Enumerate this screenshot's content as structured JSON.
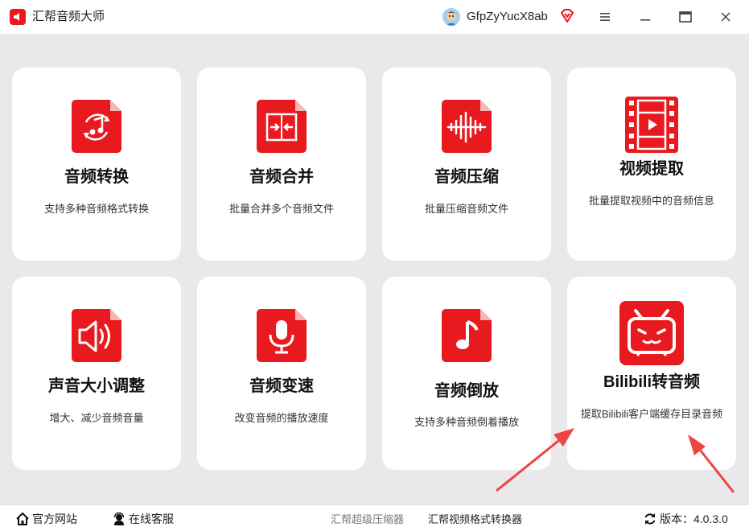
{
  "app": {
    "title": "汇帮音频大师"
  },
  "user": {
    "name": "GfpZyYucX8ab"
  },
  "colors": {
    "accent": "#e8191f",
    "background": "#e9e9ec",
    "card": "#ffffff"
  },
  "cards": [
    {
      "title": "音频转换",
      "desc": "支持多种音频格式转换",
      "icon": "audio-convert-icon"
    },
    {
      "title": "音频合并",
      "desc": "批量合并多个音频文件",
      "icon": "audio-merge-icon"
    },
    {
      "title": "音频压缩",
      "desc": "批量压缩音频文件",
      "icon": "audio-compress-icon"
    },
    {
      "title": "视频提取",
      "desc": "批量提取视频中的音频信息",
      "icon": "video-extract-icon"
    },
    {
      "title": "声音大小调整",
      "desc": "增大、减少音频音量",
      "icon": "volume-icon"
    },
    {
      "title": "音频变速",
      "desc": "改变音频的播放速度",
      "icon": "microphone-icon"
    },
    {
      "title": "音频倒放",
      "desc": "支持多种音频倒着播放",
      "icon": "music-note-icon"
    },
    {
      "title": "Bilibili转音频",
      "desc": "提取Bilibili客户端缓存目录音频",
      "icon": "bilibili-tv-icon"
    }
  ],
  "footer": {
    "website": "官方网站",
    "support": "在线客服",
    "compressor": "汇帮超级压缩器",
    "video_converter": "汇帮视频格式转换器",
    "version": "版本：4.0.3.0"
  }
}
